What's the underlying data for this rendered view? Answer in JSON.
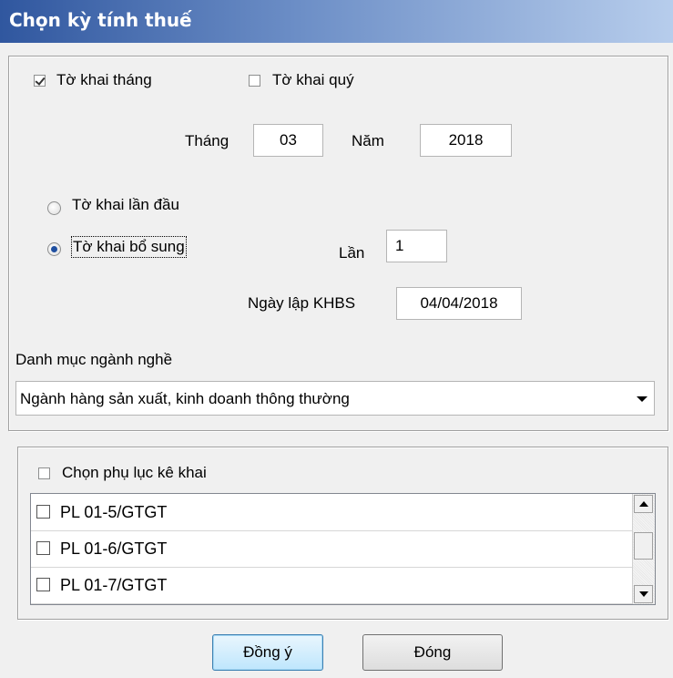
{
  "window": {
    "title": "Chọn kỳ tính thuế"
  },
  "period": {
    "monthly_label": "Tờ khai tháng",
    "monthly_checked": true,
    "quarterly_label": "Tờ khai quý",
    "quarterly_checked": false,
    "month_label": "Tháng",
    "month_value": "03",
    "year_label": "Năm",
    "year_value": "2018"
  },
  "declaration": {
    "first_label": "Tờ khai lần đầu",
    "supplementary_label": "Tờ khai bổ sung",
    "selected": "supplementary",
    "times_label": "Lần",
    "times_value": "1",
    "date_label": "Ngày lập KHBS",
    "date_value": "04/04/2018"
  },
  "industry": {
    "label": "Danh mục ngành nghề",
    "selected": "Ngành hàng sản xuất, kinh doanh thông thường"
  },
  "appendix": {
    "select_label": "Chọn phụ lục kê khai",
    "items": [
      {
        "label": "PL 01-5/GTGT",
        "checked": false
      },
      {
        "label": "PL 01-6/GTGT",
        "checked": false
      },
      {
        "label": "PL 01-7/GTGT",
        "checked": false
      }
    ]
  },
  "buttons": {
    "ok": "Đồng ý",
    "close": "Đóng"
  }
}
